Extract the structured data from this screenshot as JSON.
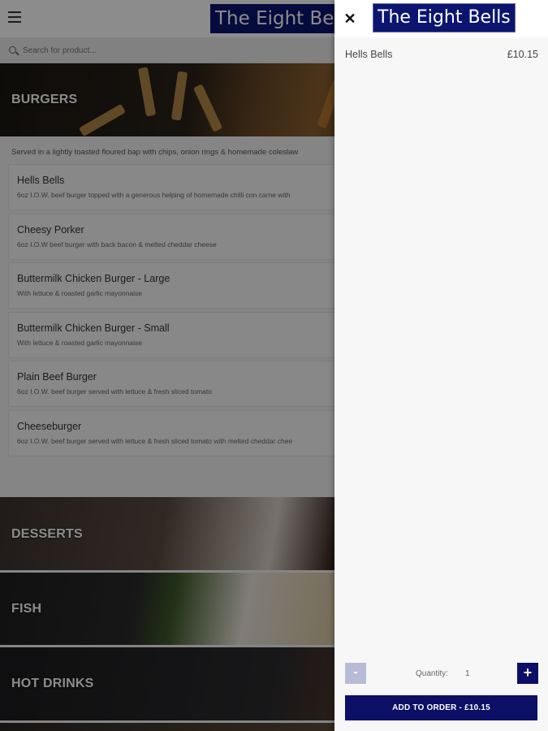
{
  "app": {
    "logo_text": "The Eight Bells",
    "search": {
      "placeholder": "Search for product..."
    }
  },
  "categories": {
    "burgers": {
      "label": "BURGERS",
      "description": "Served in a lightly toasted floured bap with chips, onion rings & homemade coleslaw",
      "items": [
        {
          "name": "Hells Bells",
          "desc": "6oz I.O.W. beef burger topped with a generous helping of homemade chilli con carne with"
        },
        {
          "name": "Cheesy Porker",
          "desc": "6oz I.O.W beef burger with back bacon & melted cheddar cheese"
        },
        {
          "name": "Buttermilk Chicken Burger - Large",
          "desc": "With lettuce & roasted garlic mayonnaise"
        },
        {
          "name": "Buttermilk Chicken Burger - Small",
          "desc": "With lettuce & roasted garlic mayonnaise"
        },
        {
          "name": "Plain Beef Burger",
          "desc": "6oz I.O.W. beef burger served with lettuce & fresh sliced tomato"
        },
        {
          "name": "Cheeseburger",
          "desc": "6oz I.O.W. beef burger served with lettuce & fresh sliced tomato with melted cheddar chee"
        }
      ]
    },
    "desserts": {
      "label": "DESSERTS"
    },
    "fish": {
      "label": "FISH"
    },
    "hot_drinks": {
      "label": "HOT DRINKS"
    }
  },
  "panel": {
    "close_symbol": "✕",
    "logo_text": "The Eight Bells",
    "product_name": "Hells Bells",
    "product_price": "£10.15",
    "quantity_label": "Quantity:",
    "quantity_value": "1",
    "minus_symbol": "-",
    "plus_symbol": "+",
    "add_button_label": "ADD TO ORDER  -  £10.15"
  },
  "colors": {
    "brand_navy": "#0b0f66",
    "logo_bg": "#0b1570",
    "minus_disabled": "#b8bbd6"
  }
}
